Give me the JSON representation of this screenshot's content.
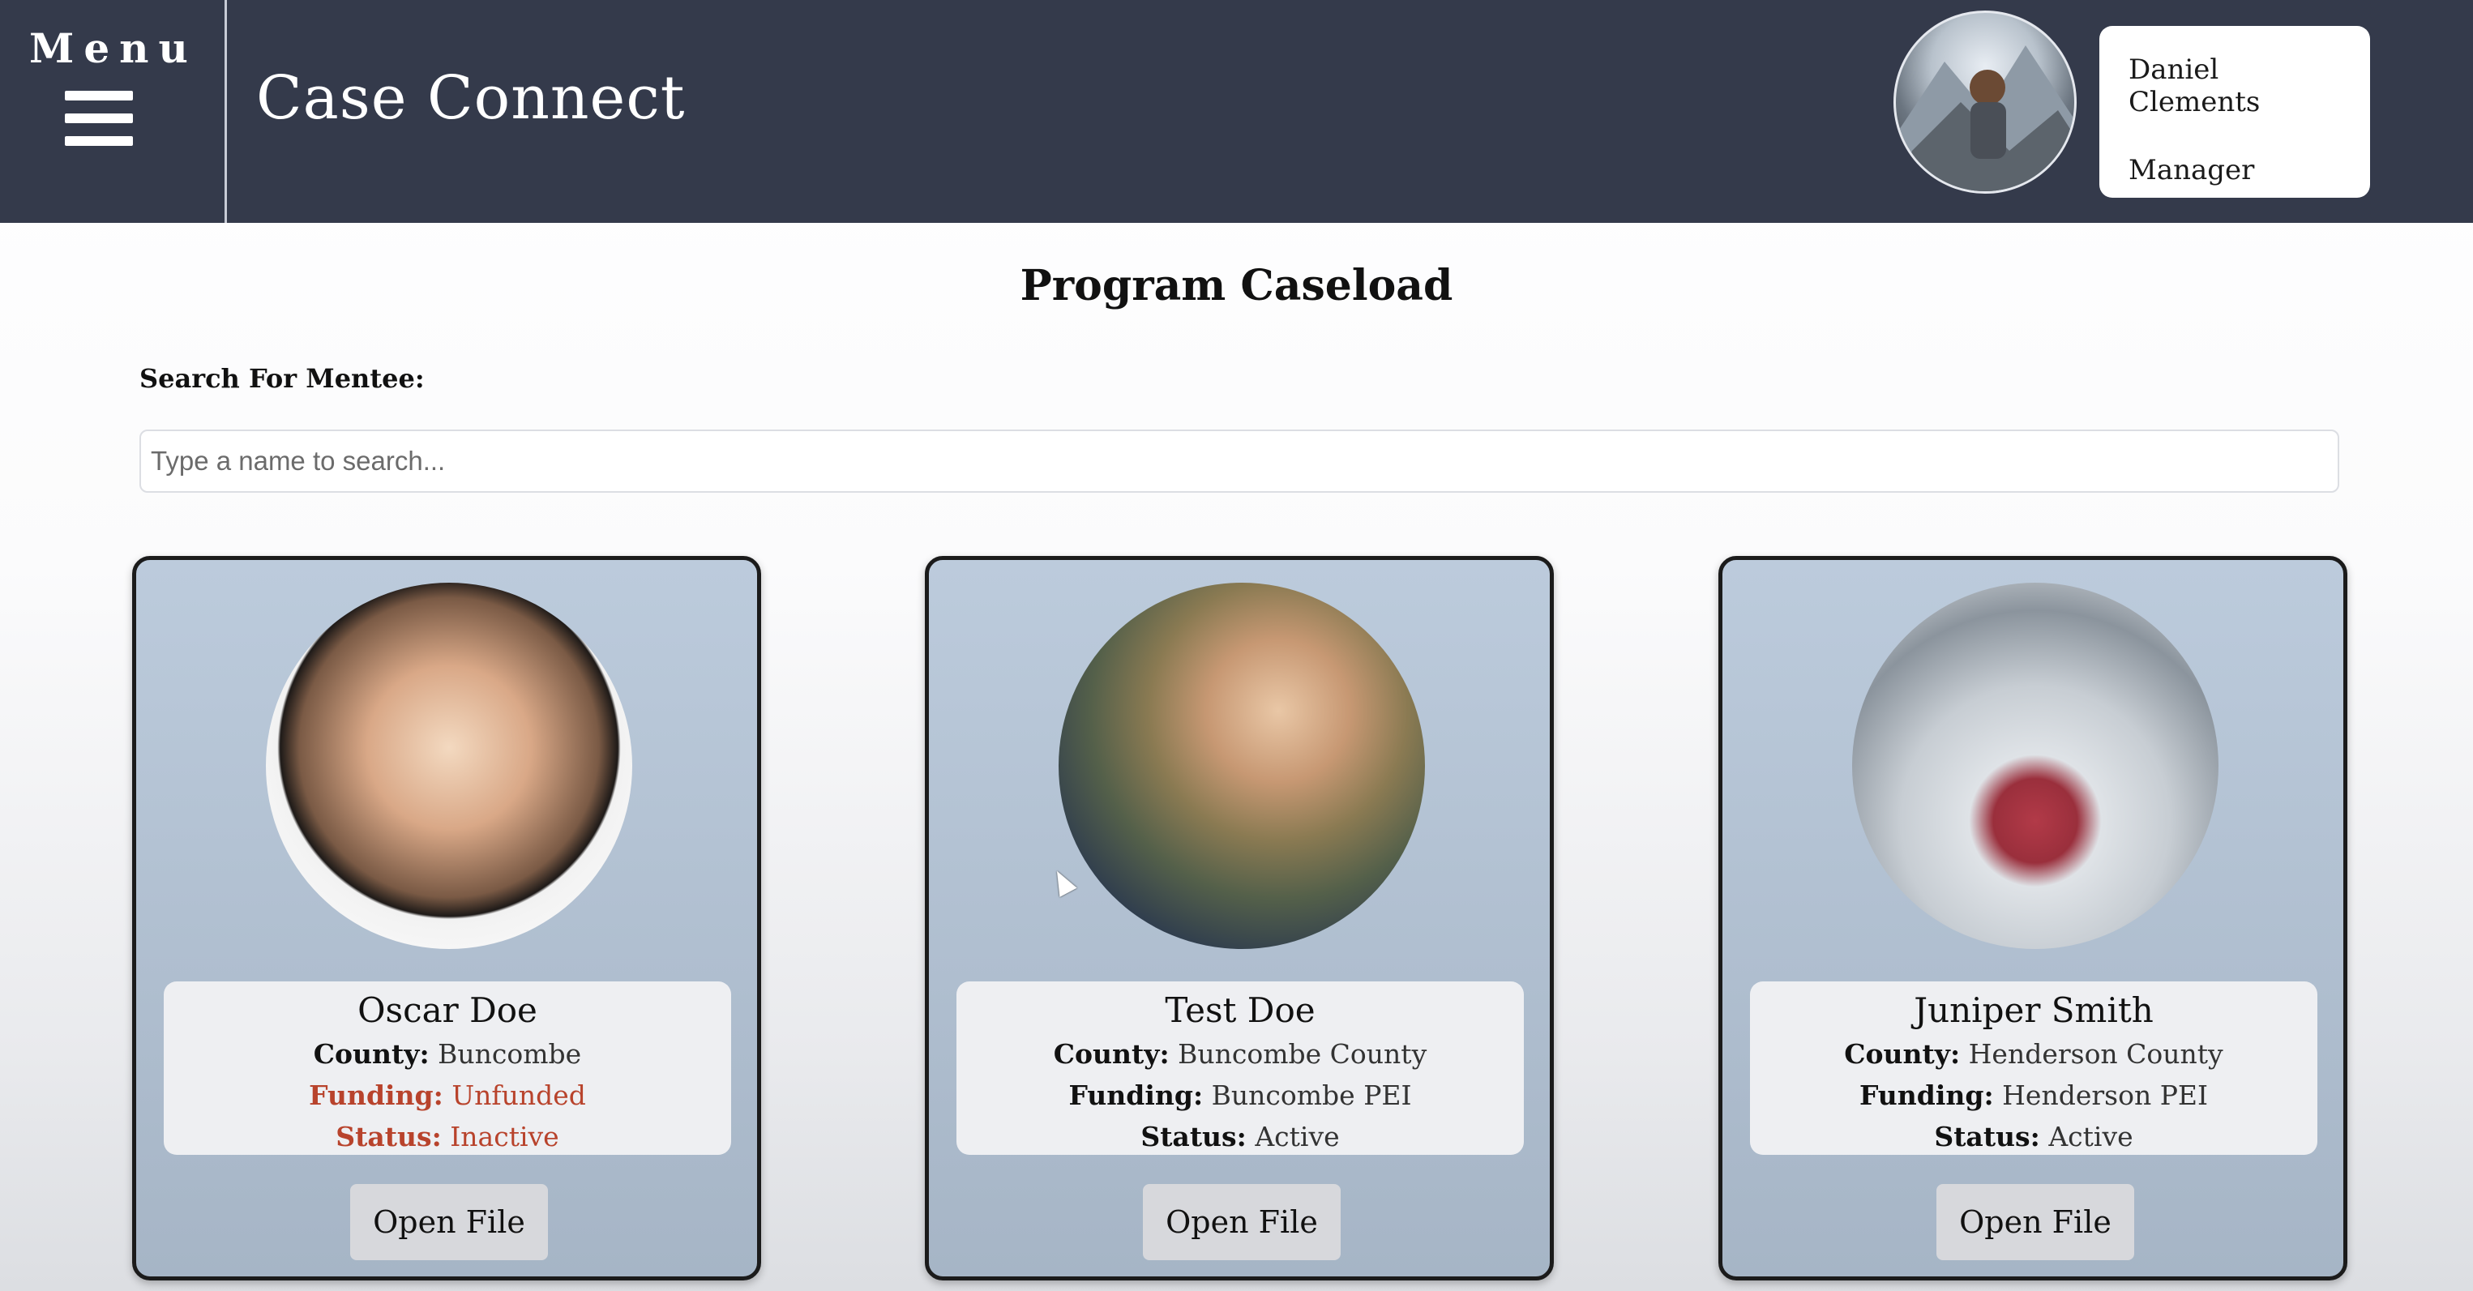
{
  "header": {
    "menu_label": "Menu",
    "app_title": "Case Connect",
    "user": {
      "name": "Daniel Clements",
      "role": "Manager"
    }
  },
  "main": {
    "title": "Program Caseload",
    "search": {
      "label": "Search For Mentee:",
      "placeholder": "Type a name to search...",
      "value": ""
    }
  },
  "labels": {
    "county": "County:",
    "funding": "Funding:",
    "status": "Status:"
  },
  "cards": [
    {
      "name": "Oscar Doe",
      "county": "Buncombe",
      "funding": "Unfunded",
      "status": "Inactive",
      "button_label": "Open File"
    },
    {
      "name": "Test Doe",
      "county": "Buncombe County",
      "funding": "Buncombe PEI",
      "status": "Active",
      "button_label": "Open File"
    },
    {
      "name": "Juniper Smith",
      "county": "Henderson County",
      "funding": "Henderson PEI",
      "status": "Active",
      "button_label": "Open File"
    }
  ],
  "colors": {
    "header_bg": "#343a4b",
    "card_bg": "#b2c1d2",
    "warning_text": "#b8432c"
  },
  "icons": {
    "menu": "hamburger-icon",
    "cursor": "mouse-pointer-icon"
  }
}
